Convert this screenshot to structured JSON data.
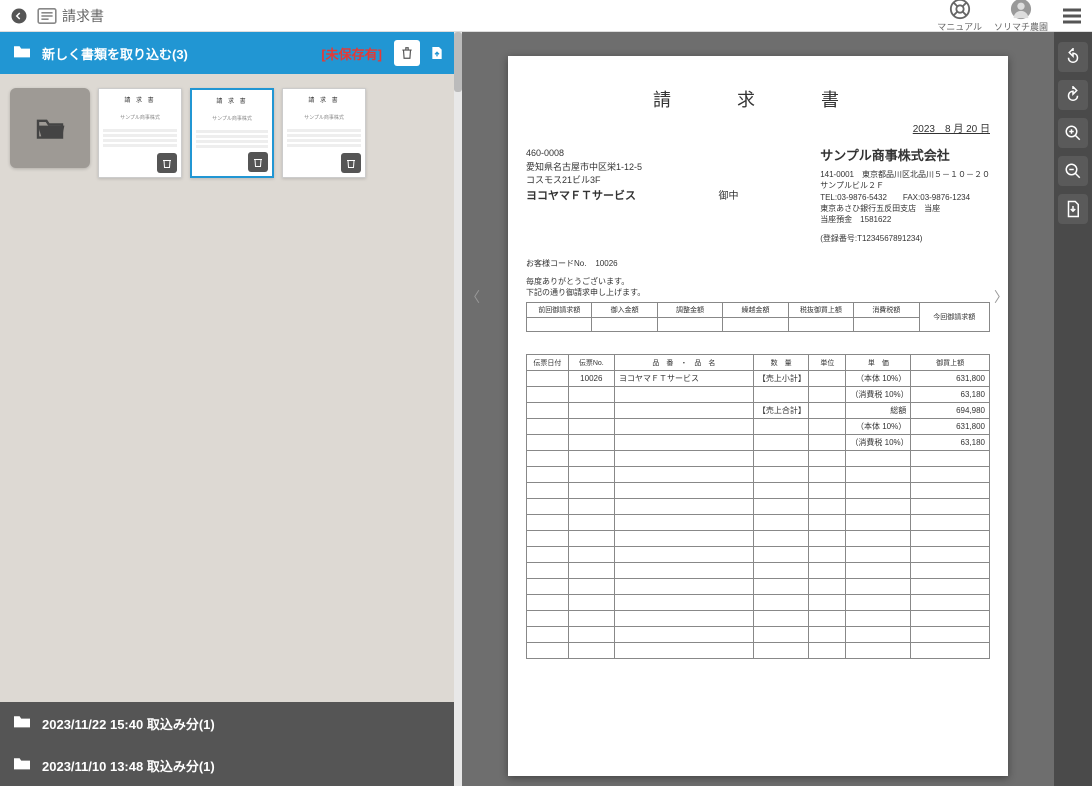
{
  "header": {
    "title": "請求書",
    "manual_label": "マニュアル",
    "user_label": "ソリマチ農園"
  },
  "left": {
    "new_import_label": "新しく書類を取り込む(3)",
    "unsaved_label": "[未保存有]",
    "thumbs": [
      {
        "title": "請 求 書",
        "sub": "サンプル商事株式"
      },
      {
        "title": "請 求 書",
        "sub": "サンプル商事株式"
      },
      {
        "title": "請 求 書",
        "sub": "サンプル商事株式"
      }
    ],
    "batches": [
      {
        "label": "2023/11/22 15:40 取込み分(1)"
      },
      {
        "label": "2023/11/10 13:48 取込み分(1)"
      }
    ]
  },
  "doc": {
    "title": "請　求　書",
    "date": "2023　8 月 20 日",
    "recipient": {
      "zip": "460-0008",
      "addr1": "愛知県名古屋市中区栄1-12-5",
      "addr2": "コスモス21ビル3F",
      "name": "ヨコヤマＦＴサービス",
      "onchuu": "御中"
    },
    "sender": {
      "company": "サンプル商事株式会社",
      "zip_addr": "141-0001　東京都品川区北品川５－１０－２０",
      "building": "サンプルビル２Ｆ",
      "tel_fax": "TEL:03-9876-5432　　FAX:03-9876-1234",
      "bank": "東京あさひ銀行五反田支店　当座",
      "account": "当座預金　1581622",
      "reg_no": "(登録番号:T1234567891234)"
    },
    "customer_code_label": "お客様コードNo.",
    "customer_code": "10026",
    "thanks1": "毎度ありがとうございます。",
    "thanks2": "下記の通り御請求申し上げます。",
    "summary_headers": [
      "前回御請求額",
      "御入金額",
      "調整金額",
      "繰越金額",
      "税抜御買上額",
      "消費税額",
      "今回御請求額"
    ],
    "detail_headers": [
      "伝票日付",
      "伝票No.",
      "品　番　・　品　名",
      "数　量",
      "単位",
      "単　価",
      "御買上額"
    ],
    "details": [
      {
        "no": "10026",
        "name": "ヨコヤマＦＴサービス",
        "qty": "【売上小計】",
        "unit": "",
        "price": "（本体 10%）",
        "amt": "631,800"
      },
      {
        "no": "",
        "name": "",
        "qty": "",
        "unit": "",
        "price": "（消費税 10%）",
        "amt": "63,180"
      },
      {
        "no": "",
        "name": "",
        "qty": "【売上合計】",
        "unit": "",
        "price": "総額",
        "amt": "694,980"
      },
      {
        "no": "",
        "name": "",
        "qty": "",
        "unit": "",
        "price": "（本体 10%）",
        "amt": "631,800"
      },
      {
        "no": "",
        "name": "",
        "qty": "",
        "unit": "",
        "price": "（消費税 10%）",
        "amt": "63,180"
      }
    ]
  }
}
